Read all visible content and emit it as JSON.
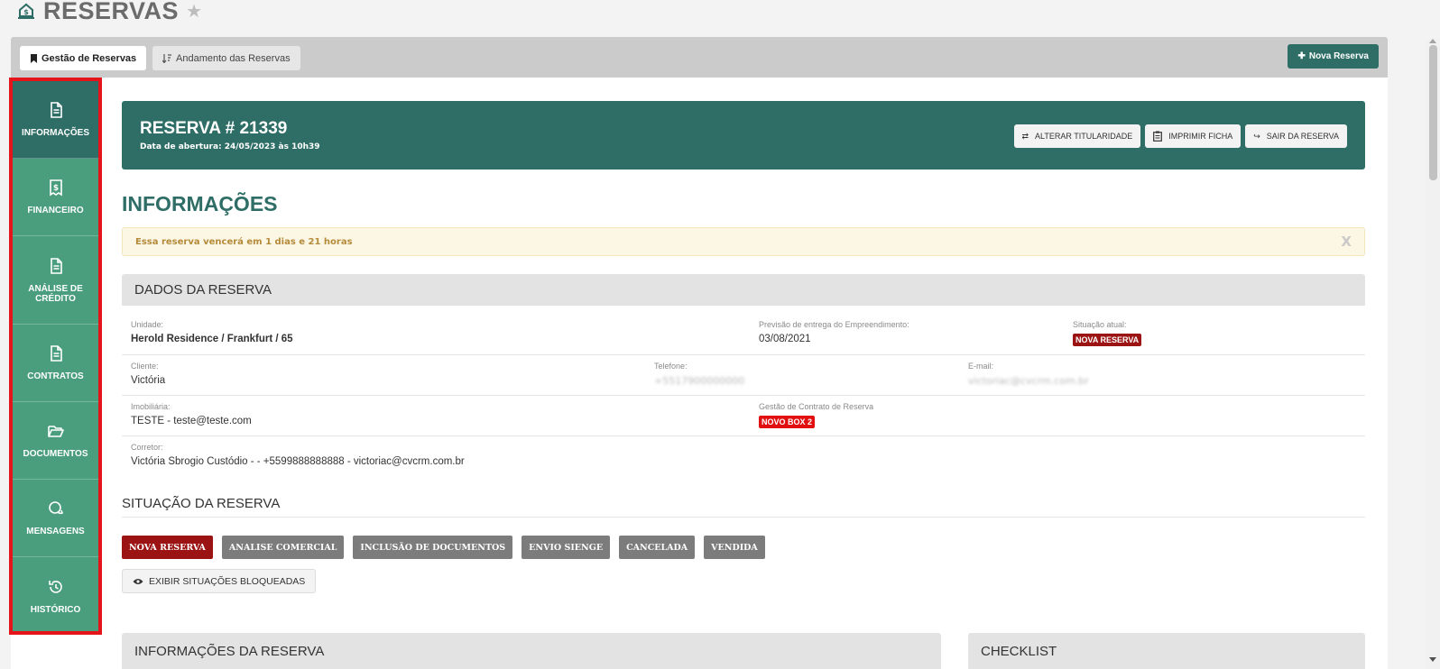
{
  "page": {
    "title": "RESERVAS",
    "logo_icon": "building-money-icon",
    "favorite_icon": "star-icon"
  },
  "top_tabs": [
    {
      "label": "Gestão de Reservas",
      "icon": "bookmark-icon",
      "active": true
    },
    {
      "label": "Andamento das Reservas",
      "icon": "sort-icon",
      "active": false
    }
  ],
  "new_button": {
    "label": "Nova Reserva",
    "icon": "plus-icon"
  },
  "sidebar": {
    "items": [
      {
        "label": "INFORMAÇÕES",
        "icon": "document-icon",
        "active": true
      },
      {
        "label": "FINANCEIRO",
        "icon": "receipt-money-icon",
        "active": false
      },
      {
        "label": "ANÁLISE DE CRÉDITO",
        "icon": "document-icon",
        "active": false
      },
      {
        "label": "CONTRATOS",
        "icon": "document-icon",
        "active": false
      },
      {
        "label": "DOCUMENTOS",
        "icon": "folder-open-icon",
        "active": false
      },
      {
        "label": "MENSAGENS",
        "icon": "chat-icon",
        "active": false
      },
      {
        "label": "HISTÓRICO",
        "icon": "history-icon",
        "active": false
      }
    ]
  },
  "reservation": {
    "title": "RESERVA # 21339",
    "opened": "Data de abertura: 24/05/2023 às 10h39",
    "actions": [
      {
        "label": "ALTERAR TITULARIDADE",
        "icon": "swap-icon"
      },
      {
        "label": "IMPRIMIR FICHA",
        "icon": "clipboard-icon"
      },
      {
        "label": "SAIR DA RESERVA",
        "icon": "share-arrow-icon"
      }
    ]
  },
  "section_title": "INFORMAÇÕES",
  "alert": {
    "text": "Essa reserva vencerá em 1 dias e 21 horas",
    "close": "X"
  },
  "dados": {
    "header": "DADOS DA RESERVA",
    "unidade_label": "Unidade:",
    "unidade": "Herold Residence / Frankfurt / 65",
    "previsao_label": "Previsão de entrega do Empreendimento:",
    "previsao": "03/08/2021",
    "situacao_label": "Situação atual:",
    "situacao": "NOVA RESERVA",
    "cliente_label": "Cliente:",
    "cliente": "Victória",
    "telefone_label": "Telefone:",
    "telefone": "+5517900000000",
    "email_label": "E-mail:",
    "email": "victoriac@cvcrm.com.br",
    "imobiliaria_label": "Imobiliária:",
    "imobiliaria": "TESTE - teste@teste.com",
    "gestao_label": "Gestão de Contrato de Reserva",
    "gestao": "NOVO BOX 2",
    "corretor_label": "Corretor:",
    "corretor": "Victória Sbrogio Custódio - - +5599888888888 - victoriac@cvcrm.com.br"
  },
  "situacao": {
    "title": "SITUAÇÃO DA RESERVA",
    "steps": [
      "NOVA RESERVA",
      "ANALISE COMERCIAL",
      "INCLUSÃO DE DOCUMENTOS",
      "ENVIO SIENGE",
      "CANCELADA",
      "VENDIDA"
    ],
    "current": "NOVA RESERVA",
    "show_blocked": "EXIBIR SITUAÇÕES BLOQUEADAS"
  },
  "bottom_panels": {
    "info": "INFORMAÇÕES DA RESERVA",
    "checklist": "CHECKLIST"
  },
  "colors": {
    "primary": "#2e6e66",
    "sidebar": "#4a9e7e",
    "highlight_border": "#e5141a",
    "status_current": "#9b1313",
    "status_other": "#7c7c7c"
  }
}
